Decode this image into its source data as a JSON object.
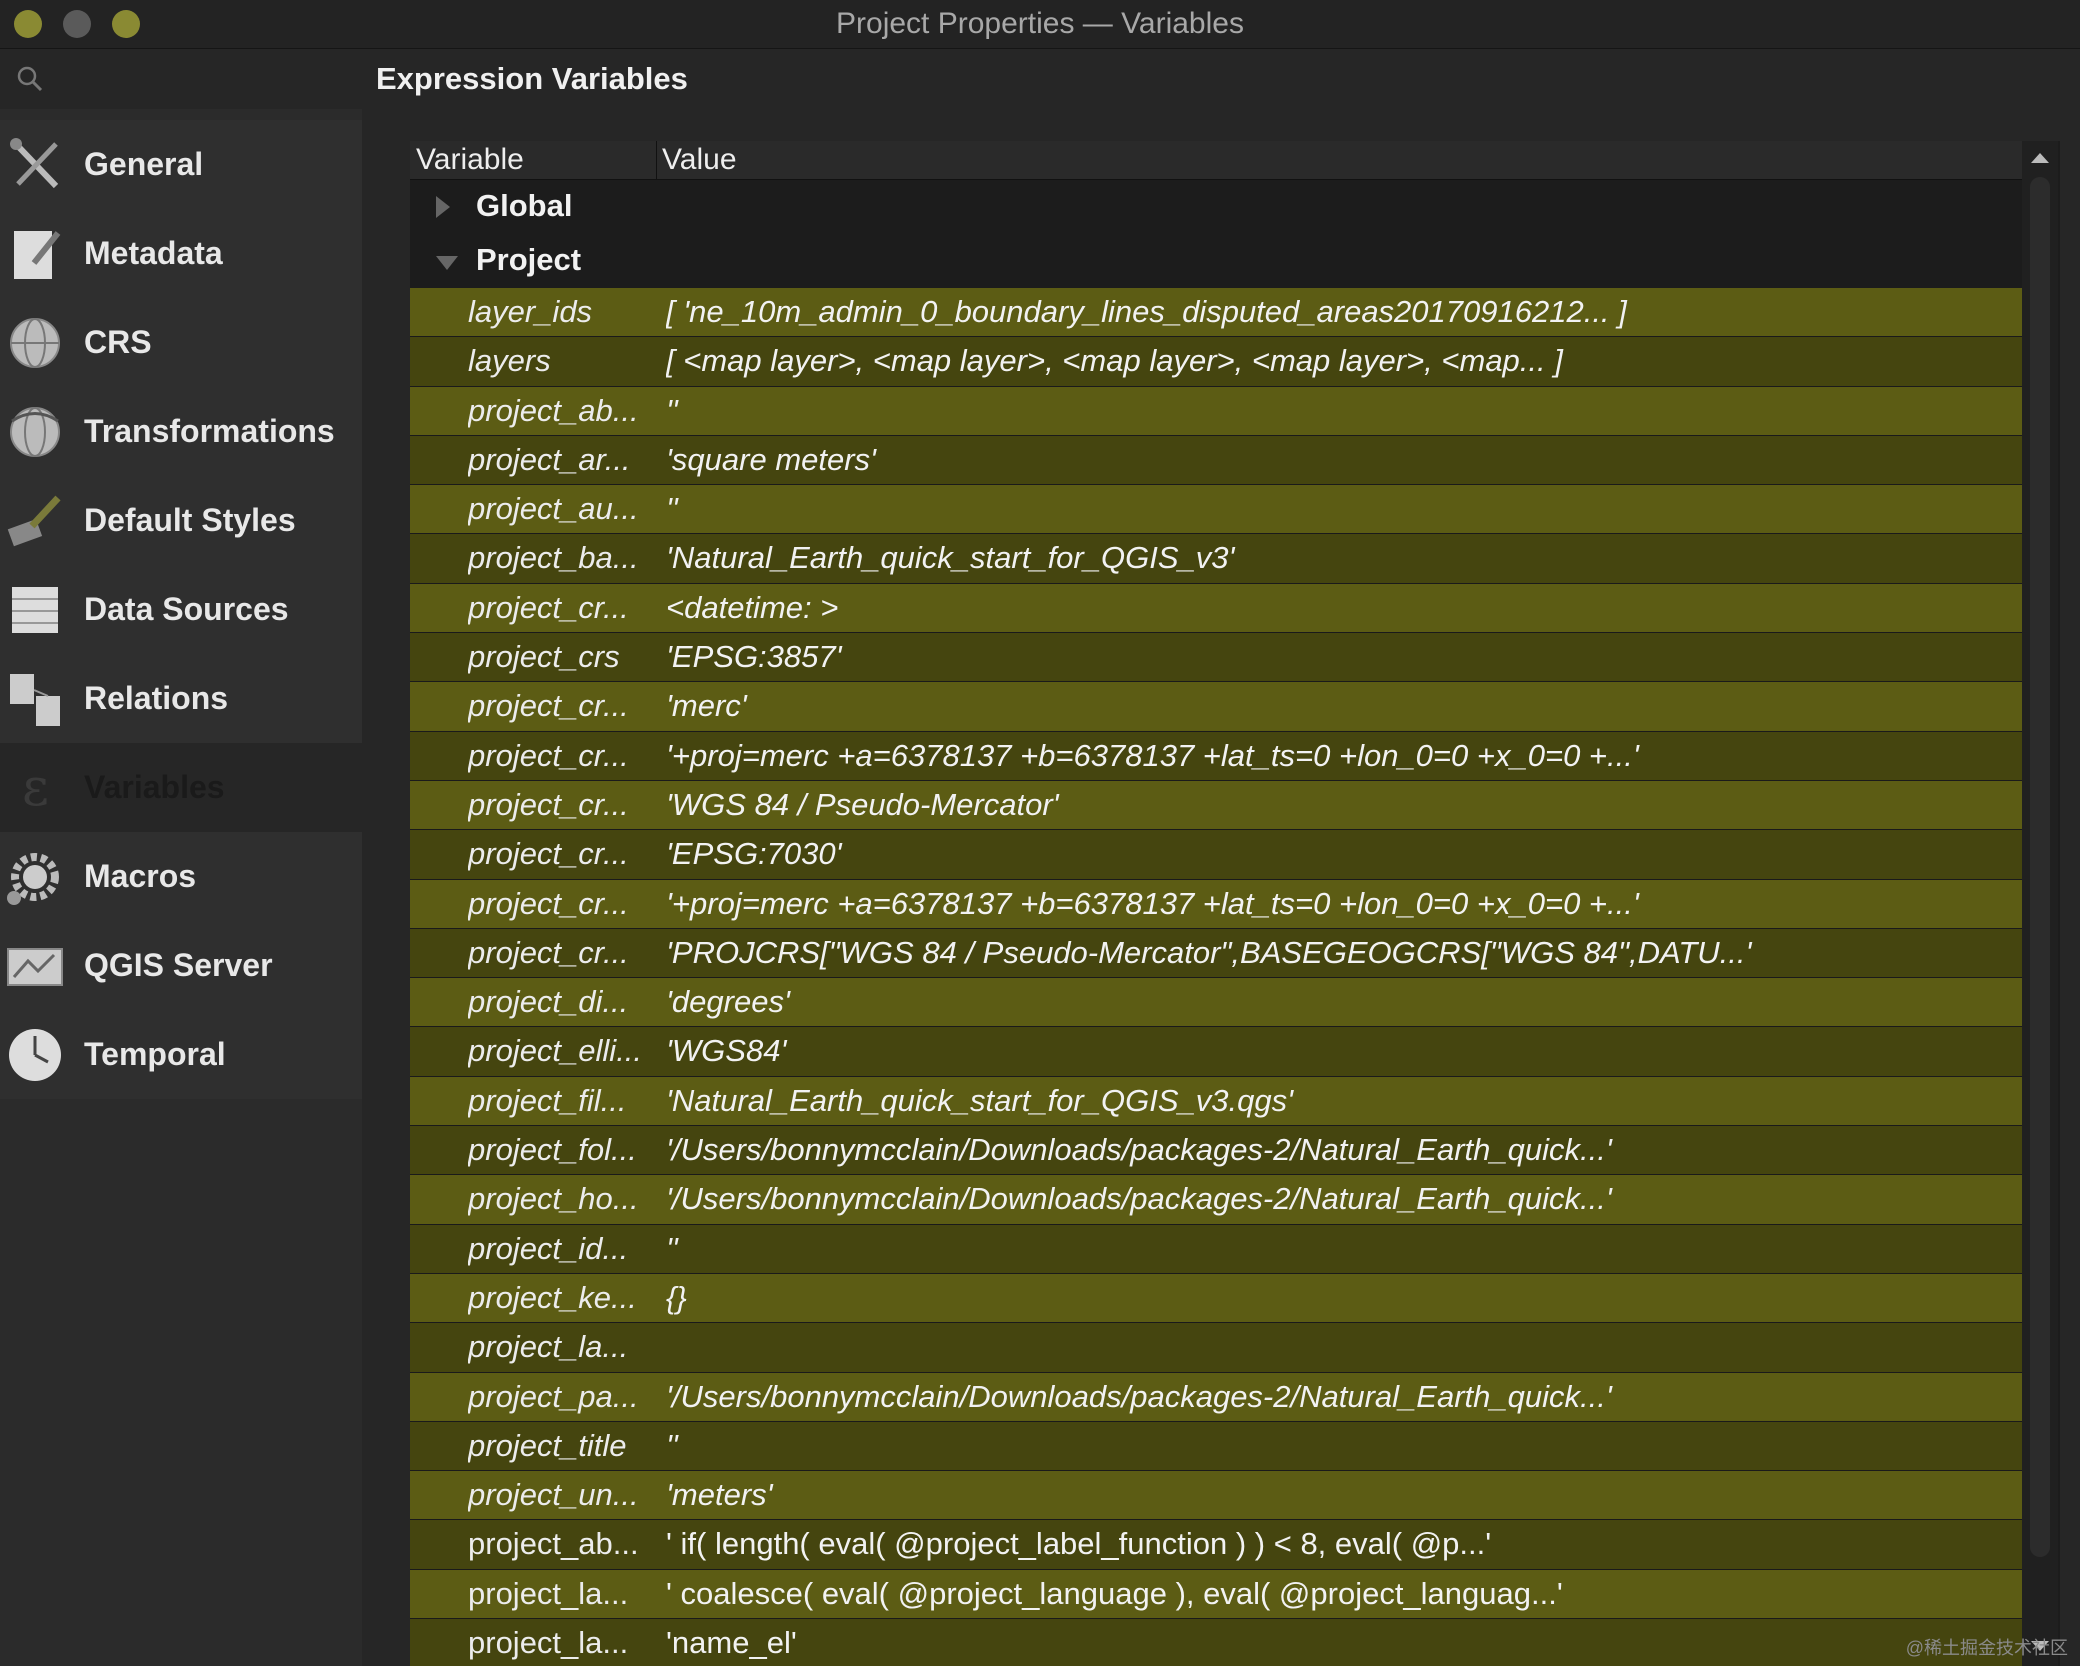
{
  "window": {
    "title": "Project Properties — Variables"
  },
  "sidebar": {
    "items": [
      {
        "label": "General",
        "icon": "wrench-screwdriver-icon"
      },
      {
        "label": "Metadata",
        "icon": "document-pencil-icon"
      },
      {
        "label": "CRS",
        "icon": "globe-icon"
      },
      {
        "label": "Transformations",
        "icon": "globe-transform-icon"
      },
      {
        "label": "Default Styles",
        "icon": "paintbrush-icon"
      },
      {
        "label": "Data Sources",
        "icon": "table-icon"
      },
      {
        "label": "Relations",
        "icon": "relations-icon"
      },
      {
        "label": "Variables",
        "icon": "epsilon-icon",
        "selected": true
      },
      {
        "label": "Macros",
        "icon": "gear-icon"
      },
      {
        "label": "QGIS Server",
        "icon": "server-icon"
      },
      {
        "label": "Temporal",
        "icon": "clock-icon"
      }
    ]
  },
  "panel": {
    "title": "Expression Variables"
  },
  "table": {
    "headers": {
      "variable": "Variable",
      "value": "Value"
    },
    "groups": [
      {
        "label": "Global",
        "expanded": false
      },
      {
        "label": "Project",
        "expanded": true
      }
    ],
    "rows": [
      {
        "name": "layer_ids",
        "value": "[ 'ne_10m_admin_0_boundary_lines_disputed_areas20170916212... ]"
      },
      {
        "name": "layers",
        "value": "[ <map layer>, <map layer>, <map layer>, <map layer>, <map... ]"
      },
      {
        "name": "project_ab...",
        "value": "''"
      },
      {
        "name": "project_ar...",
        "value": "'square meters'"
      },
      {
        "name": "project_au...",
        "value": "''"
      },
      {
        "name": "project_ba...",
        "value": "'Natural_Earth_quick_start_for_QGIS_v3'"
      },
      {
        "name": "project_cr...",
        "value": "<datetime: >"
      },
      {
        "name": "project_crs",
        "value": "'EPSG:3857'"
      },
      {
        "name": "project_cr...",
        "value": "'merc'"
      },
      {
        "name": "project_cr...",
        "value": "'+proj=merc +a=6378137 +b=6378137 +lat_ts=0 +lon_0=0 +x_0=0 +...'"
      },
      {
        "name": "project_cr...",
        "value": "'WGS 84 / Pseudo-Mercator'"
      },
      {
        "name": "project_cr...",
        "value": "'EPSG:7030'"
      },
      {
        "name": "project_cr...",
        "value": "'+proj=merc +a=6378137 +b=6378137 +lat_ts=0 +lon_0=0 +x_0=0 +...'"
      },
      {
        "name": "project_cr...",
        "value": "'PROJCRS[\"WGS 84 / Pseudo-Mercator\",BASEGEOGCRS[\"WGS 84\",DATU...'"
      },
      {
        "name": "project_di...",
        "value": "'degrees'"
      },
      {
        "name": "project_elli...",
        "value": "'WGS84'"
      },
      {
        "name": "project_fil...",
        "value": "'Natural_Earth_quick_start_for_QGIS_v3.qgs'"
      },
      {
        "name": "project_fol...",
        "value": "'/Users/bonnymcclain/Downloads/packages-2/Natural_Earth_quick...'"
      },
      {
        "name": "project_ho...",
        "value": "'/Users/bonnymcclain/Downloads/packages-2/Natural_Earth_quick...'"
      },
      {
        "name": "project_id...",
        "value": "''"
      },
      {
        "name": "project_ke...",
        "value": "{}"
      },
      {
        "name": "project_la...",
        "value": ""
      },
      {
        "name": "project_pa...",
        "value": "'/Users/bonnymcclain/Downloads/packages-2/Natural_Earth_quick...'"
      },
      {
        "name": "project_title",
        "value": "''"
      },
      {
        "name": "project_un...",
        "value": "'meters'"
      },
      {
        "name": "project_ab...",
        "value": "' if( length( eval( @project_label_function ) ) < 8, eval( @p...'",
        "plain": true
      },
      {
        "name": "project_la...",
        "value": "' coalesce( eval( @project_language ), eval( @project_languag...'",
        "plain": true
      },
      {
        "name": "project_la...",
        "value": "'name_el'",
        "plain": true
      }
    ]
  },
  "watermark": "@稀土掘金技术社区",
  "colors": {
    "row_odd": "#5c5c14",
    "row_even": "#45450f"
  }
}
